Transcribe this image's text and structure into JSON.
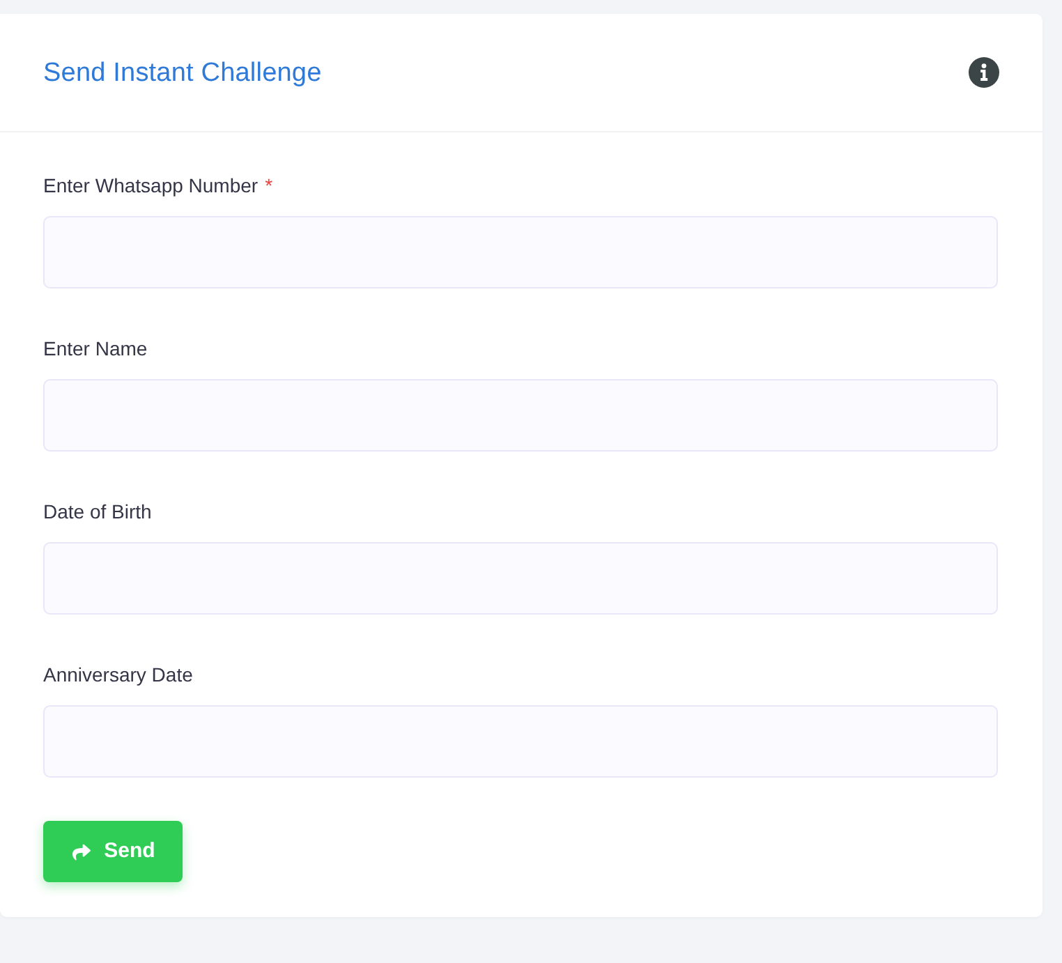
{
  "card": {
    "title": "Send Instant Challenge"
  },
  "fields": [
    {
      "label": "Enter Whatsapp Number",
      "required_mark": "*"
    },
    {
      "label": "Enter Name"
    },
    {
      "label": "Date of Birth"
    },
    {
      "label": "Anniversary Date"
    }
  ],
  "submit_button": {
    "label": "Send"
  }
}
